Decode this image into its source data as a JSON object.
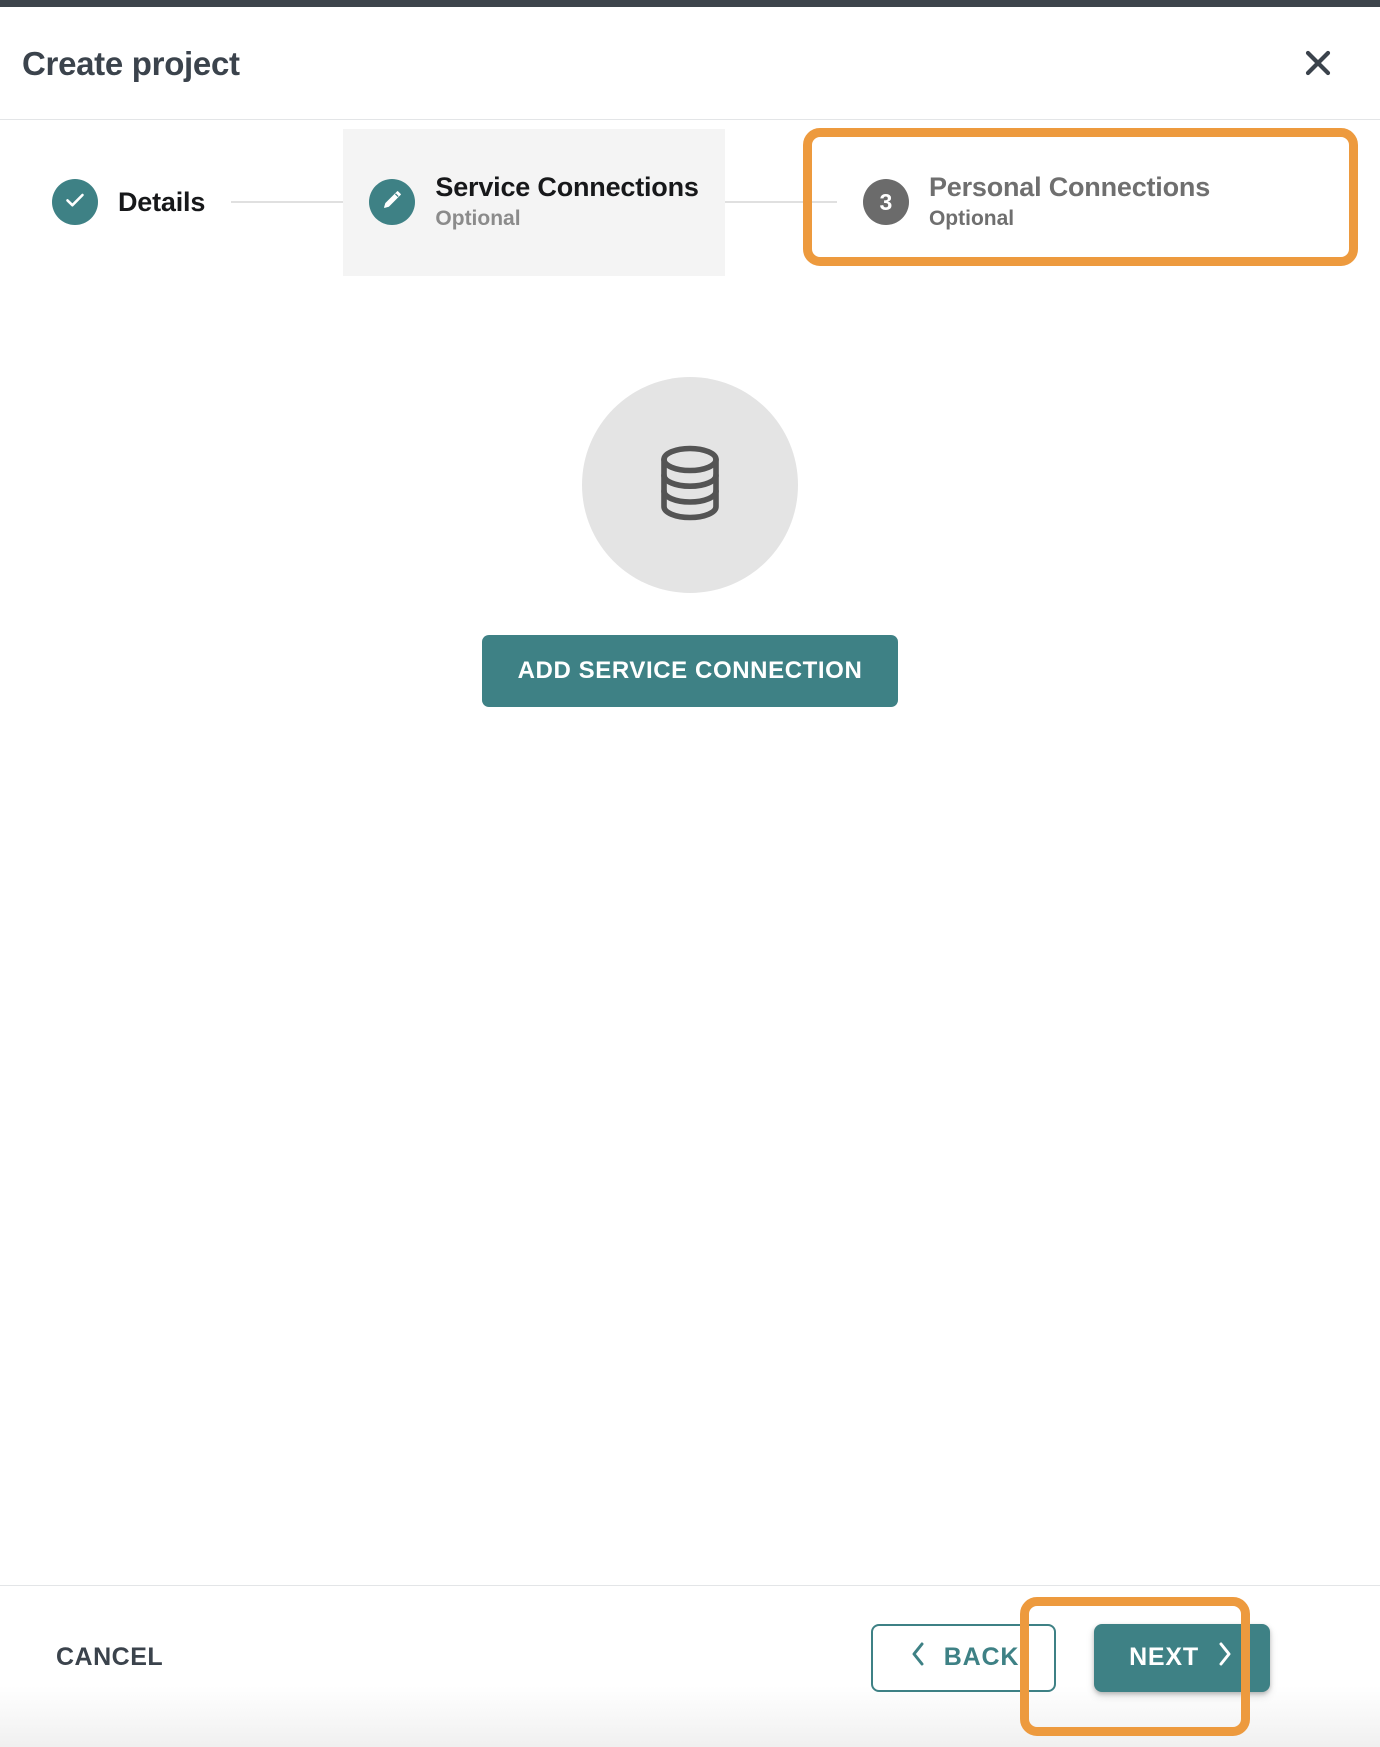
{
  "dialog": {
    "title": "Create project",
    "close_icon": "close-icon"
  },
  "stepper": {
    "steps": [
      {
        "index": "1",
        "label": "Details",
        "sub": "",
        "state": "completed",
        "icon": "check-icon"
      },
      {
        "index": "2",
        "label": "Service Connections",
        "sub": "Optional",
        "state": "active",
        "icon": "pencil-icon"
      },
      {
        "index": "3",
        "label": "Personal Connections",
        "sub": "Optional",
        "state": "upcoming",
        "icon": "number"
      }
    ]
  },
  "body": {
    "empty_icon": "database-icon",
    "add_connection_label": "ADD SERVICE CONNECTION"
  },
  "footer": {
    "cancel_label": "CANCEL",
    "back_label": "BACK",
    "back_icon": "chevron-left-icon",
    "next_label": "NEXT",
    "next_icon": "chevron-right-icon"
  },
  "colors": {
    "accent_teal": "#3e8185",
    "highlight_orange": "#ed9a3e",
    "title_text": "#3b434c",
    "muted_text": "#8b8b8b",
    "step_circle_gray": "#6b6b6b",
    "empty_circle_bg": "#e4e4e4",
    "top_strip": "#3d444b"
  },
  "annotations": {
    "highlight_targets": [
      "step-3-personal-connections",
      "next-button"
    ]
  }
}
